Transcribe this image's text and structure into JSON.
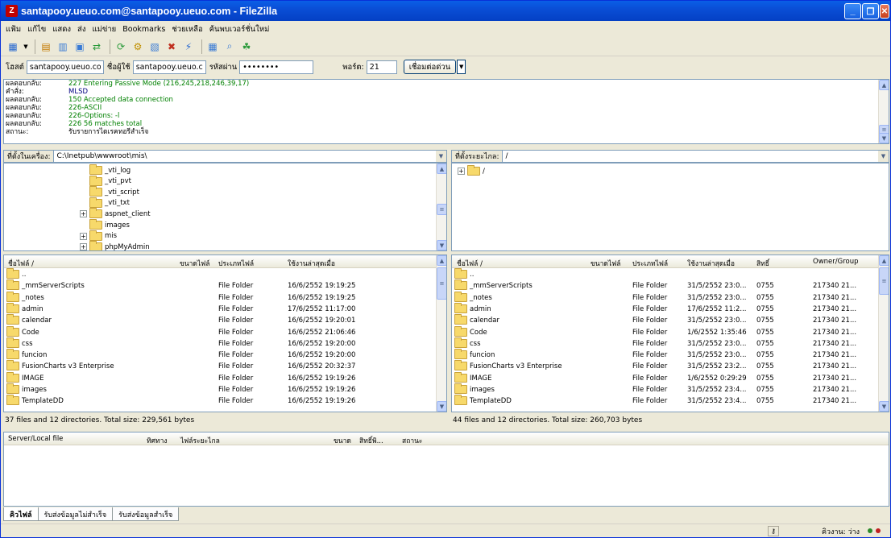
{
  "window": {
    "title": "santapooy.ueuo.com@santapooy.ueuo.com - FileZilla"
  },
  "menu": [
    "แฟ้ม",
    "แก้ไข",
    "แสดง",
    "ส่ง",
    "แม่ข่าย",
    "Bookmarks",
    "ช่วยเหลือ",
    "ค้นพบเวอร์ชั่นใหม่"
  ],
  "quickconnect": {
    "host_label": "โฮสต์",
    "host_value": "santapooy.ueuo.com",
    "user_label": "ชื่อผู้ใช้",
    "user_value": "santapooy.ueuo.cc",
    "pass_label": "รหัสผ่าน",
    "pass_value": "••••••••",
    "port_label": "พอร์ต:",
    "port_value": "21",
    "connect_label": "เชื่อมต่อด่วน"
  },
  "log": [
    {
      "k": "ผลตอบกลับ:",
      "v": "227 Entering Passive Mode (216,245,218,246,39,17)",
      "c": "#008000"
    },
    {
      "k": "คำสั่ง:",
      "v": "MLSD",
      "c": "#000080"
    },
    {
      "k": "ผลตอบกลับ:",
      "v": "150 Accepted data connection",
      "c": "#008000"
    },
    {
      "k": "ผลตอบกลับ:",
      "v": "226-ASCII",
      "c": "#008000"
    },
    {
      "k": "ผลตอบกลับ:",
      "v": "226-Options: -l",
      "c": "#008000"
    },
    {
      "k": "ผลตอบกลับ:",
      "v": "226 56 matches total",
      "c": "#008000"
    },
    {
      "k": "สถานะ:",
      "v": "รับรายการไดเรคทอรีสำเร็จ",
      "c": "#000000"
    }
  ],
  "local": {
    "path_label": "ที่ตั้งในเครื่อง:",
    "path": "C:\\Inetpub\\wwwroot\\mis\\",
    "tree": [
      {
        "name": "_vti_log",
        "plus": false
      },
      {
        "name": "_vti_pvt",
        "plus": false
      },
      {
        "name": "_vti_script",
        "plus": false
      },
      {
        "name": "_vti_txt",
        "plus": false
      },
      {
        "name": "aspnet_client",
        "plus": true
      },
      {
        "name": "images",
        "plus": false
      },
      {
        "name": "mis",
        "plus": true
      },
      {
        "name": "phpMyAdmin",
        "plus": true
      }
    ],
    "headers": {
      "name": "ชื่อไฟล์",
      "size": "ขนาดไฟล์",
      "type": "ประเภทไฟล์",
      "modified": "ใช้งานล่าสุดเมื่อ"
    },
    "files": [
      {
        "name": "..",
        "type": "",
        "modified": ""
      },
      {
        "name": "_mmServerScripts",
        "type": "File Folder",
        "modified": "16/6/2552 19:19:25"
      },
      {
        "name": "_notes",
        "type": "File Folder",
        "modified": "16/6/2552 19:19:25"
      },
      {
        "name": "admin",
        "type": "File Folder",
        "modified": "17/6/2552 11:17:00"
      },
      {
        "name": "calendar",
        "type": "File Folder",
        "modified": "16/6/2552 19:20:01"
      },
      {
        "name": "Code",
        "type": "File Folder",
        "modified": "16/6/2552 21:06:46"
      },
      {
        "name": "css",
        "type": "File Folder",
        "modified": "16/6/2552 19:20:00"
      },
      {
        "name": "funcion",
        "type": "File Folder",
        "modified": "16/6/2552 19:20:00"
      },
      {
        "name": "FusionCharts v3 Enterprise",
        "type": "File Folder",
        "modified": "16/6/2552 20:32:37"
      },
      {
        "name": "IMAGE",
        "type": "File Folder",
        "modified": "16/6/2552 19:19:26"
      },
      {
        "name": "images",
        "type": "File Folder",
        "modified": "16/6/2552 19:19:26"
      },
      {
        "name": "TemplateDD",
        "type": "File Folder",
        "modified": "16/6/2552 19:19:26"
      }
    ],
    "status": "37 files and 12 directories. Total size: 229,561 bytes"
  },
  "remote": {
    "path_label": "ที่ตั้งระยะไกล:",
    "path": "/",
    "tree_root": "/",
    "headers": {
      "name": "ชื่อไฟล์",
      "size": "ขนาดไฟล์",
      "type": "ประเภทไฟล์",
      "modified": "ใช้งานล่าสุดเมื่อ",
      "perm": "สิทธิ์",
      "owner": "Owner/Group"
    },
    "files": [
      {
        "name": "..",
        "type": "",
        "modified": "",
        "perm": "",
        "owner": ""
      },
      {
        "name": "_mmServerScripts",
        "type": "File Folder",
        "modified": "31/5/2552 23:0...",
        "perm": "0755",
        "owner": "217340 21..."
      },
      {
        "name": "_notes",
        "type": "File Folder",
        "modified": "31/5/2552 23:0...",
        "perm": "0755",
        "owner": "217340 21..."
      },
      {
        "name": "admin",
        "type": "File Folder",
        "modified": "17/6/2552 11:2...",
        "perm": "0755",
        "owner": "217340 21..."
      },
      {
        "name": "calendar",
        "type": "File Folder",
        "modified": "31/5/2552 23:0...",
        "perm": "0755",
        "owner": "217340 21..."
      },
      {
        "name": "Code",
        "type": "File Folder",
        "modified": "1/6/2552 1:35:46",
        "perm": "0755",
        "owner": "217340 21..."
      },
      {
        "name": "css",
        "type": "File Folder",
        "modified": "31/5/2552 23:0...",
        "perm": "0755",
        "owner": "217340 21..."
      },
      {
        "name": "funcion",
        "type": "File Folder",
        "modified": "31/5/2552 23:0...",
        "perm": "0755",
        "owner": "217340 21..."
      },
      {
        "name": "FusionCharts v3 Enterprise",
        "type": "File Folder",
        "modified": "31/5/2552 23:2...",
        "perm": "0755",
        "owner": "217340 21..."
      },
      {
        "name": "IMAGE",
        "type": "File Folder",
        "modified": "1/6/2552 0:29:29",
        "perm": "0755",
        "owner": "217340 21..."
      },
      {
        "name": "images",
        "type": "File Folder",
        "modified": "31/5/2552 23:4...",
        "perm": "0755",
        "owner": "217340 21..."
      },
      {
        "name": "TemplateDD",
        "type": "File Folder",
        "modified": "31/5/2552 23:4...",
        "perm": "0755",
        "owner": "217340 21..."
      }
    ],
    "status": "44 files and 12 directories. Total size: 260,703 bytes"
  },
  "queue": {
    "headers": {
      "file": "Server/Local file",
      "dir": "ทิศทาง",
      "remote": "ไฟล์ระยะไกล",
      "size": "ขนาด",
      "prio": "สิทธิ์พิ...",
      "status": "สถานะ"
    }
  },
  "tabs": [
    "คิวไฟล์",
    "รับส่งข้อมูลไม่สำเร็จ",
    "รับส่งข้อมูลสำเร็จ"
  ],
  "statusbar": {
    "queue": "คิวงาน: ว่าง"
  }
}
